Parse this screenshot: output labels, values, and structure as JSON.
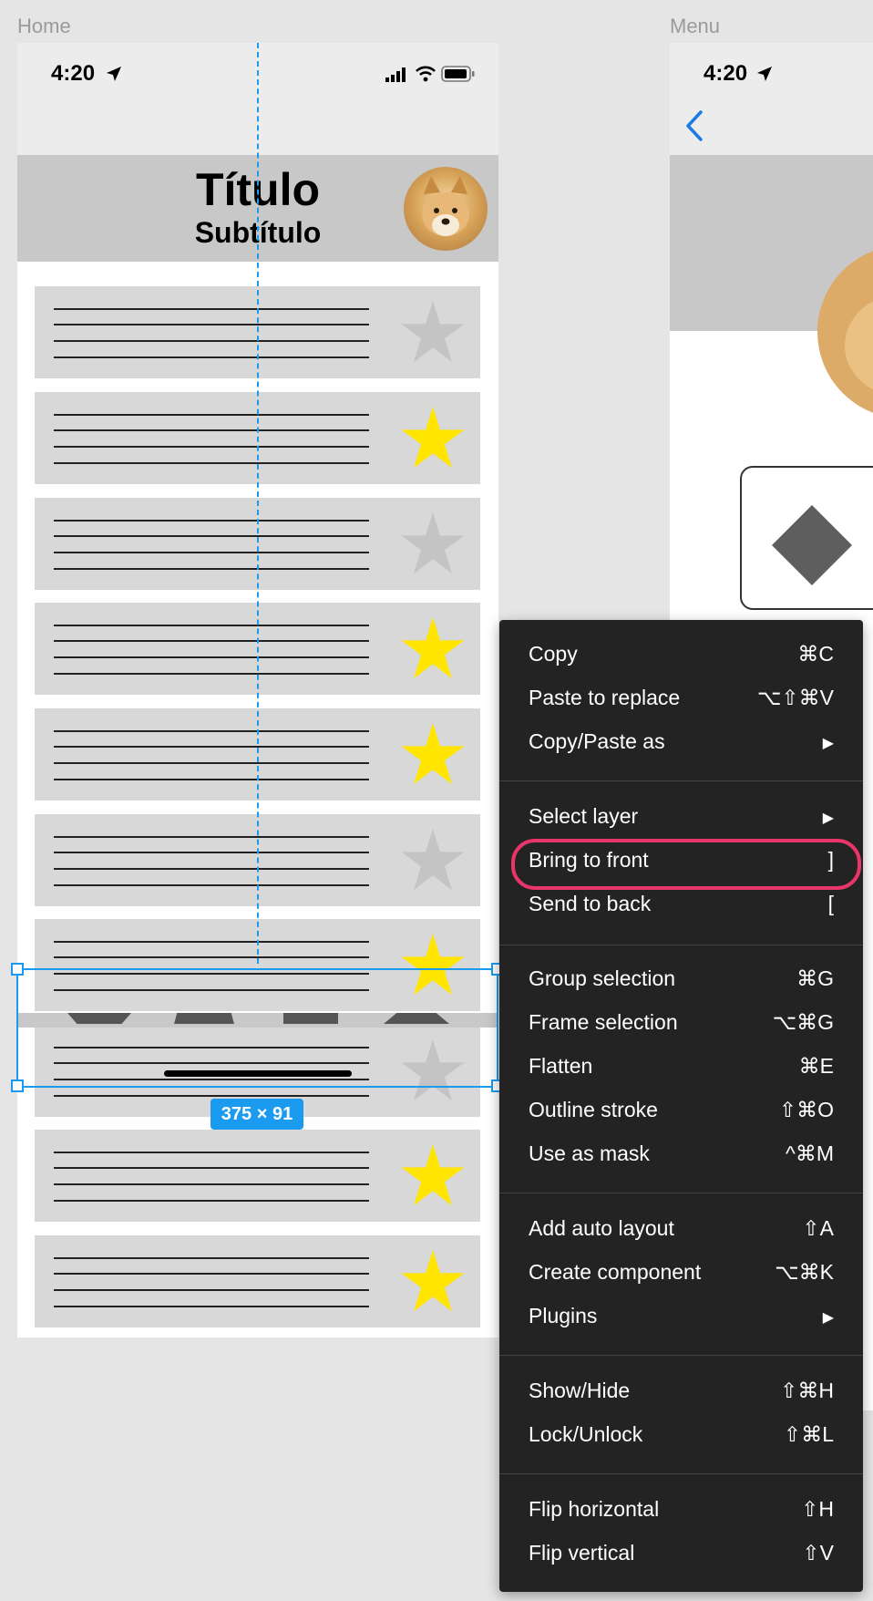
{
  "frames": {
    "home_label": "Home",
    "menu_label": "Menu"
  },
  "home": {
    "status_time": "4:20",
    "title": "Título",
    "subtitle": "Subtítulo",
    "cards": [
      {
        "starred": false
      },
      {
        "starred": true
      },
      {
        "starred": false
      },
      {
        "starred": true
      },
      {
        "starred": true
      },
      {
        "starred": false
      },
      {
        "starred": true
      },
      {
        "starred": false
      },
      {
        "starred": true
      },
      {
        "starred": true
      }
    ]
  },
  "menu_frame": {
    "status_time": "4:20"
  },
  "selection": {
    "size_label": "375 × 91"
  },
  "context_menu": {
    "items": [
      {
        "label": "Copy",
        "shortcut": "⌘C"
      },
      {
        "label": "Paste to replace",
        "shortcut": "⌥⇧⌘V"
      },
      {
        "label": "Copy/Paste as",
        "shortcut": "▶"
      },
      {
        "label": "Select layer",
        "shortcut": "▶"
      },
      {
        "label": "Bring to front",
        "shortcut": "]",
        "highlighted": true
      },
      {
        "label": "Send to back",
        "shortcut": "["
      },
      {
        "label": "Group selection",
        "shortcut": "⌘G"
      },
      {
        "label": "Frame selection",
        "shortcut": "⌥⌘G"
      },
      {
        "label": "Flatten",
        "shortcut": "⌘E"
      },
      {
        "label": "Outline stroke",
        "shortcut": "⇧⌘O"
      },
      {
        "label": "Use as mask",
        "shortcut": "^⌘M"
      },
      {
        "label": "Add auto layout",
        "shortcut": "⇧A"
      },
      {
        "label": "Create component",
        "shortcut": "⌥⌘K"
      },
      {
        "label": "Plugins",
        "shortcut": "▶"
      },
      {
        "label": "Show/Hide",
        "shortcut": "⇧⌘H"
      },
      {
        "label": "Lock/Unlock",
        "shortcut": "⇧⌘L"
      },
      {
        "label": "Flip horizontal",
        "shortcut": "⇧H"
      },
      {
        "label": "Flip vertical",
        "shortcut": "⇧V"
      }
    ]
  },
  "colors": {
    "star_on": "#ffe500",
    "star_off": "#c4c4c4",
    "selection": "#1a9bf0",
    "highlight_ring": "#e8366a"
  },
  "icons": [
    "location-arrow-icon",
    "signal-icon",
    "wifi-icon",
    "battery-icon",
    "back-chevron-icon",
    "star-icon",
    "diamond-icon",
    "submenu-arrow-icon"
  ]
}
